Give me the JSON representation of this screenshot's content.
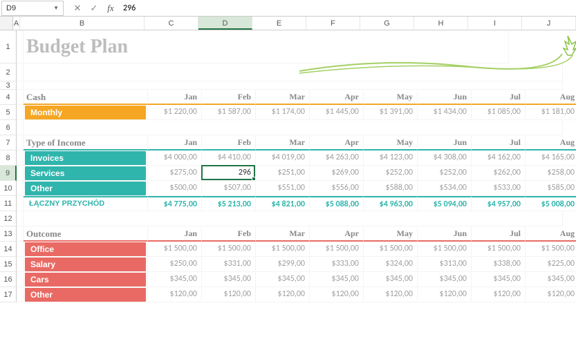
{
  "namebox": "D9",
  "formula_input": "296",
  "columns": [
    "A",
    "B",
    "C",
    "D",
    "E",
    "F",
    "G",
    "H",
    "I",
    "J"
  ],
  "active_col": "D",
  "active_row": "9",
  "title": "Budget Plan",
  "months": [
    "Jan",
    "Feb",
    "Mar",
    "Apr",
    "May",
    "Jun",
    "Jul",
    "Aug"
  ],
  "cash": {
    "label": "Cash",
    "rows": [
      {
        "label": "Monthly",
        "vals": [
          "$1 220,00",
          "$1 587,00",
          "$1 174,00",
          "$1 445,00",
          "$1 391,00",
          "$1 434,00",
          "$1 085,00",
          "$1 181,00"
        ]
      }
    ]
  },
  "income": {
    "label": "Type of Income",
    "rows": [
      {
        "label": "Invoices",
        "vals": [
          "$4 000,00",
          "$4 410,00",
          "$4 019,00",
          "$4 263,00",
          "$4 123,00",
          "$4 308,00",
          "$4 162,00",
          "$4 165,00"
        ]
      },
      {
        "label": "Services",
        "vals": [
          "$275,00",
          "296",
          "$251,00",
          "$269,00",
          "$252,00",
          "$252,00",
          "$262,00",
          "$258,00"
        ]
      },
      {
        "label": "Other",
        "vals": [
          "$500,00",
          "$507,00",
          "$551,00",
          "$556,00",
          "$588,00",
          "$534,00",
          "$533,00",
          "$585,00"
        ]
      }
    ],
    "total_label": "ŁĄCZNY PRZYCHÓD",
    "totals": [
      "$4 775,00",
      "$5 213,00",
      "$4 821,00",
      "$5 088,00",
      "$4 963,00",
      "$5 094,00",
      "$4 957,00",
      "$5 008,00"
    ]
  },
  "outcome": {
    "label": "Outcome",
    "rows": [
      {
        "label": "Office",
        "vals": [
          "$1 500,00",
          "$1 500,00",
          "$1 500,00",
          "$1 500,00",
          "$1 500,00",
          "$1 500,00",
          "$1 500,00",
          "$1 500,00"
        ]
      },
      {
        "label": "Salary",
        "vals": [
          "$250,00",
          "$331,00",
          "$299,00",
          "$333,00",
          "$324,00",
          "$313,00",
          "$338,00",
          "$225,00"
        ]
      },
      {
        "label": "Cars",
        "vals": [
          "$345,00",
          "$345,00",
          "$345,00",
          "$345,00",
          "$345,00",
          "$345,00",
          "$345,00",
          "$345,00"
        ]
      },
      {
        "label": "Other",
        "vals": [
          "$120,00",
          "$120,00",
          "$120,00",
          "$120,00",
          "$120,00",
          "$120,00",
          "$120,00",
          "$120,00"
        ]
      }
    ]
  },
  "active_cell_value": "296",
  "chart_data": {
    "type": "table",
    "title": "Budget Plan",
    "sections": [
      {
        "name": "Cash",
        "columns": [
          "Jan",
          "Feb",
          "Mar",
          "Apr",
          "May",
          "Jun",
          "Jul",
          "Aug"
        ],
        "rows": [
          {
            "label": "Monthly",
            "values": [
              1220,
              1587,
              1174,
              1445,
              1391,
              1434,
              1085,
              1181
            ]
          }
        ]
      },
      {
        "name": "Type of Income",
        "columns": [
          "Jan",
          "Feb",
          "Mar",
          "Apr",
          "May",
          "Jun",
          "Jul",
          "Aug"
        ],
        "rows": [
          {
            "label": "Invoices",
            "values": [
              4000,
              4410,
              4019,
              4263,
              4123,
              4308,
              4162,
              4165
            ]
          },
          {
            "label": "Services",
            "values": [
              275,
              296,
              251,
              269,
              252,
              252,
              262,
              258
            ]
          },
          {
            "label": "Other",
            "values": [
              500,
              507,
              551,
              556,
              588,
              534,
              533,
              585
            ]
          }
        ],
        "totals": {
          "label": "ŁĄCZNY PRZYCHÓD",
          "values": [
            4775,
            5213,
            4821,
            5088,
            4963,
            5094,
            4957,
            5008
          ]
        }
      },
      {
        "name": "Outcome",
        "columns": [
          "Jan",
          "Feb",
          "Mar",
          "Apr",
          "May",
          "Jun",
          "Jul",
          "Aug"
        ],
        "rows": [
          {
            "label": "Office",
            "values": [
              1500,
              1500,
              1500,
              1500,
              1500,
              1500,
              1500,
              1500
            ]
          },
          {
            "label": "Salary",
            "values": [
              250,
              331,
              299,
              333,
              324,
              313,
              338,
              225
            ]
          },
          {
            "label": "Cars",
            "values": [
              345,
              345,
              345,
              345,
              345,
              345,
              345,
              345
            ]
          },
          {
            "label": "Other",
            "values": [
              120,
              120,
              120,
              120,
              120,
              120,
              120,
              120
            ]
          }
        ]
      }
    ]
  }
}
